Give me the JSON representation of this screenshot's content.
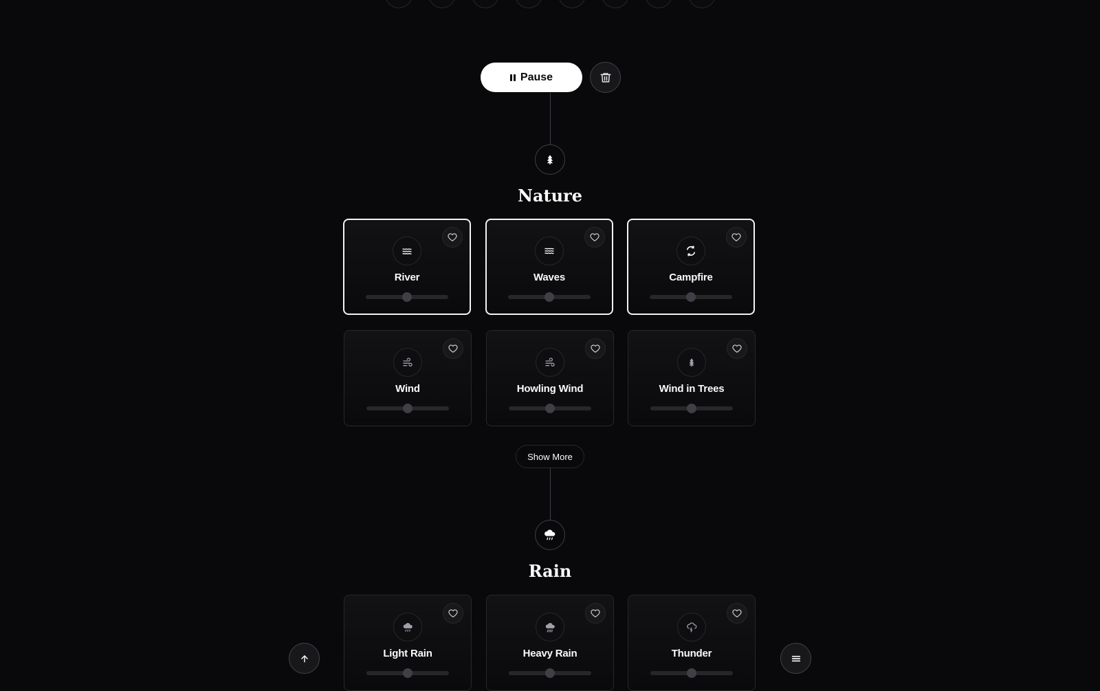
{
  "player": {
    "pause_label": "Pause"
  },
  "categories": [
    {
      "title": "Nature",
      "icon": "tree-icon",
      "show_more_label": "Show More",
      "sounds": [
        {
          "label": "River",
          "icon": "river-icon",
          "active": true,
          "volume": 0.5
        },
        {
          "label": "Waves",
          "icon": "waves-icon",
          "active": true,
          "volume": 0.5
        },
        {
          "label": "Campfire",
          "icon": "campfire-icon",
          "active": true,
          "volume": 0.5
        },
        {
          "label": "Wind",
          "icon": "wind-icon",
          "active": false,
          "volume": 0.5
        },
        {
          "label": "Howling Wind",
          "icon": "wind-icon",
          "active": false,
          "volume": 0.5
        },
        {
          "label": "Wind in Trees",
          "icon": "tree-icon",
          "active": false,
          "volume": 0.5
        }
      ]
    },
    {
      "title": "Rain",
      "icon": "cloud-rain-icon",
      "sounds": [
        {
          "label": "Light Rain",
          "icon": "cloud-rain-icon",
          "active": false,
          "volume": 0.5
        },
        {
          "label": "Heavy Rain",
          "icon": "cloud-rain-icon",
          "active": false,
          "volume": 0.5
        },
        {
          "label": "Thunder",
          "icon": "cloud-lightning-icon",
          "active": false,
          "volume": 0.5
        }
      ]
    }
  ]
}
